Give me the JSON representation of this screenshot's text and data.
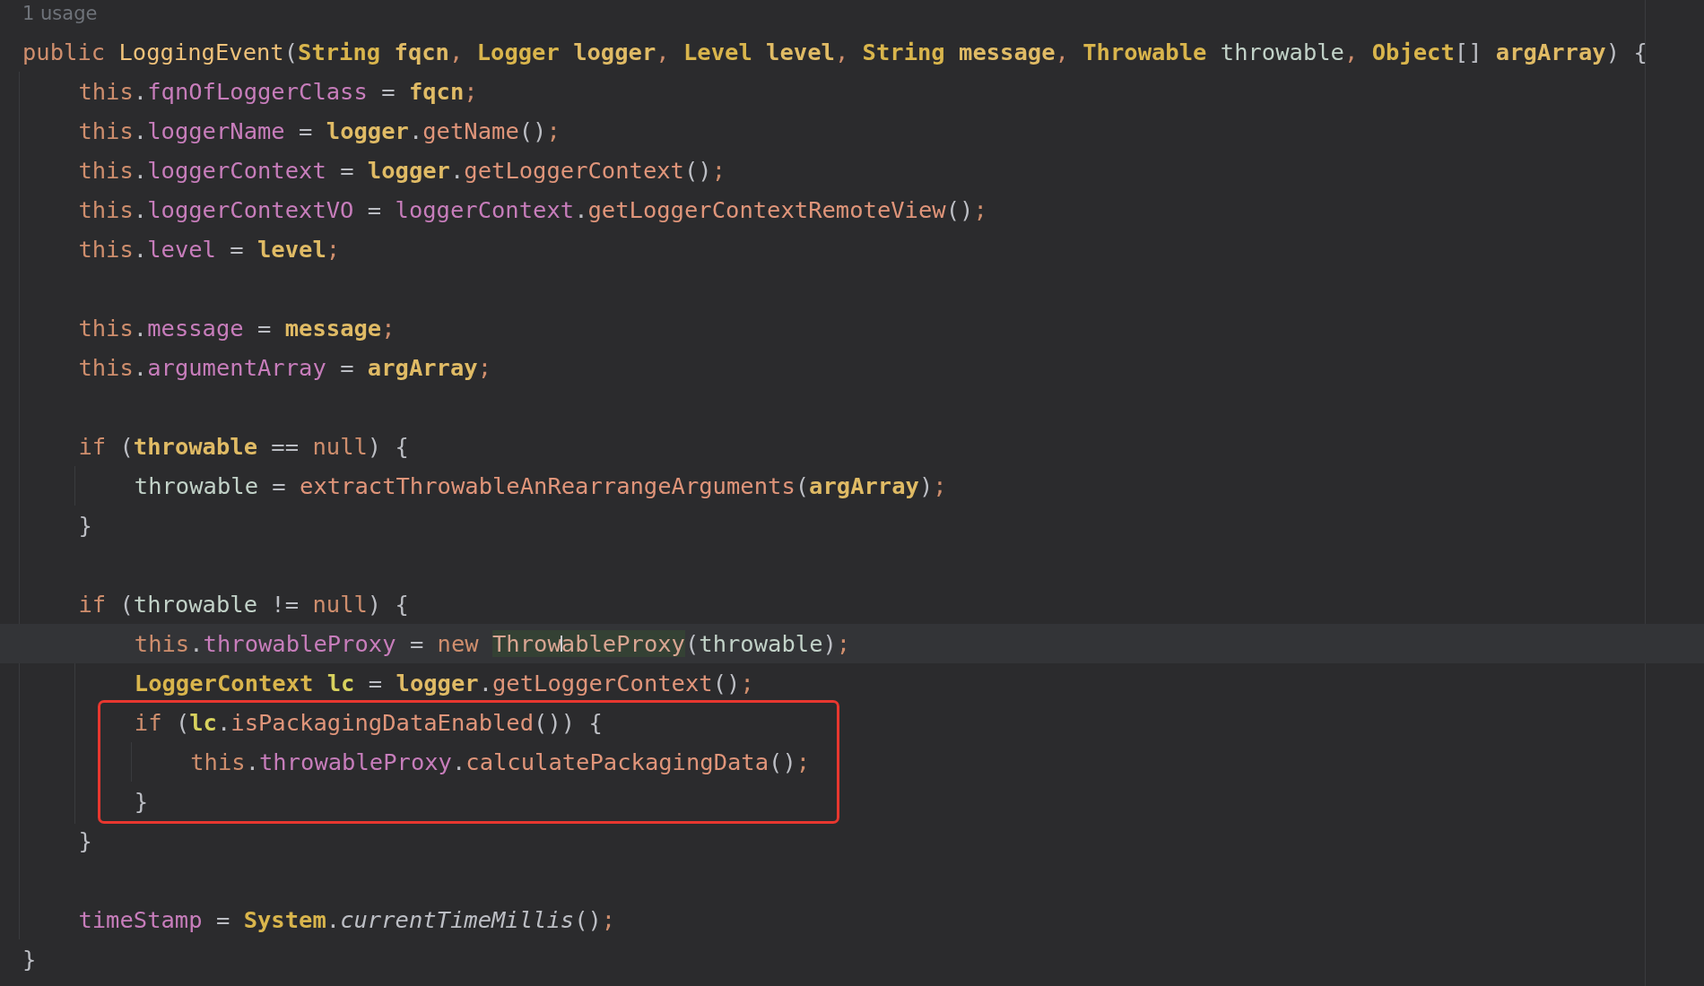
{
  "editor": {
    "usage_hint": "1 usage",
    "lines": [
      {
        "kind": "block",
        "boxed": false,
        "tokens": [
          {
            "text": "public ",
            "kind": "keyword"
          },
          {
            "text": "LoggingEvent",
            "kind": "ctor"
          },
          {
            "text": "(",
            "kind": "plain"
          },
          {
            "text": "String ",
            "kind": "type"
          },
          {
            "text": "fqcn",
            "kind": "param"
          },
          {
            "text": ", ",
            "kind": "semi"
          },
          {
            "text": "Logger ",
            "kind": "type"
          },
          {
            "text": "logger",
            "kind": "param"
          },
          {
            "text": ", ",
            "kind": "semi"
          },
          {
            "text": "Level ",
            "kind": "type"
          },
          {
            "text": "level",
            "kind": "param"
          },
          {
            "text": ", ",
            "kind": "semi"
          },
          {
            "text": "String ",
            "kind": "type"
          },
          {
            "text": "message",
            "kind": "param"
          },
          {
            "text": ", ",
            "kind": "semi"
          },
          {
            "text": "Throwable ",
            "kind": "type"
          },
          {
            "text": "throwable",
            "kind": "local"
          },
          {
            "text": ", ",
            "kind": "semi"
          },
          {
            "text": "Object",
            "kind": "type"
          },
          {
            "text": "[] ",
            "kind": "plain"
          },
          {
            "text": "argArray",
            "kind": "param"
          },
          {
            "text": ") {",
            "kind": "plain"
          }
        ],
        "children": [
          {
            "kind": "code",
            "tokens": [
              {
                "text": "this",
                "kind": "keyword"
              },
              {
                "text": ".",
                "kind": "plain"
              },
              {
                "text": "fqnOfLoggerClass",
                "kind": "field"
              },
              {
                "text": " = ",
                "kind": "plain"
              },
              {
                "text": "fqcn",
                "kind": "param"
              },
              {
                "text": ";",
                "kind": "semi"
              }
            ]
          },
          {
            "kind": "code",
            "tokens": [
              {
                "text": "this",
                "kind": "keyword"
              },
              {
                "text": ".",
                "kind": "plain"
              },
              {
                "text": "loggerName",
                "kind": "field"
              },
              {
                "text": " = ",
                "kind": "plain"
              },
              {
                "text": "logger",
                "kind": "param"
              },
              {
                "text": ".",
                "kind": "plain"
              },
              {
                "text": "getName",
                "kind": "method"
              },
              {
                "text": "()",
                "kind": "plain"
              },
              {
                "text": ";",
                "kind": "semi"
              }
            ]
          },
          {
            "kind": "code",
            "tokens": [
              {
                "text": "this",
                "kind": "keyword"
              },
              {
                "text": ".",
                "kind": "plain"
              },
              {
                "text": "loggerContext",
                "kind": "field"
              },
              {
                "text": " = ",
                "kind": "plain"
              },
              {
                "text": "logger",
                "kind": "param"
              },
              {
                "text": ".",
                "kind": "plain"
              },
              {
                "text": "getLoggerContext",
                "kind": "method"
              },
              {
                "text": "()",
                "kind": "plain"
              },
              {
                "text": ";",
                "kind": "semi"
              }
            ]
          },
          {
            "kind": "code",
            "tokens": [
              {
                "text": "this",
                "kind": "keyword"
              },
              {
                "text": ".",
                "kind": "plain"
              },
              {
                "text": "loggerContextVO",
                "kind": "field"
              },
              {
                "text": " = ",
                "kind": "plain"
              },
              {
                "text": "loggerContext",
                "kind": "field"
              },
              {
                "text": ".",
                "kind": "plain"
              },
              {
                "text": "getLoggerContextRemoteView",
                "kind": "method"
              },
              {
                "text": "()",
                "kind": "plain"
              },
              {
                "text": ";",
                "kind": "semi"
              }
            ]
          },
          {
            "kind": "code",
            "tokens": [
              {
                "text": "this",
                "kind": "keyword"
              },
              {
                "text": ".",
                "kind": "plain"
              },
              {
                "text": "level",
                "kind": "field"
              },
              {
                "text": " = ",
                "kind": "plain"
              },
              {
                "text": "level",
                "kind": "param"
              },
              {
                "text": ";",
                "kind": "semi"
              }
            ]
          },
          {
            "kind": "blank"
          },
          {
            "kind": "code",
            "tokens": [
              {
                "text": "this",
                "kind": "keyword"
              },
              {
                "text": ".",
                "kind": "plain"
              },
              {
                "text": "message",
                "kind": "field"
              },
              {
                "text": " = ",
                "kind": "plain"
              },
              {
                "text": "message",
                "kind": "param"
              },
              {
                "text": ";",
                "kind": "semi"
              }
            ]
          },
          {
            "kind": "code",
            "tokens": [
              {
                "text": "this",
                "kind": "keyword"
              },
              {
                "text": ".",
                "kind": "plain"
              },
              {
                "text": "argumentArray",
                "kind": "field"
              },
              {
                "text": " = ",
                "kind": "plain"
              },
              {
                "text": "argArray",
                "kind": "param"
              },
              {
                "text": ";",
                "kind": "semi"
              }
            ]
          },
          {
            "kind": "blank"
          },
          {
            "kind": "block",
            "boxed": false,
            "tokens": [
              {
                "text": "if ",
                "kind": "keyword"
              },
              {
                "text": "(",
                "kind": "plain"
              },
              {
                "text": "throwable",
                "kind": "param"
              },
              {
                "text": " == ",
                "kind": "plain"
              },
              {
                "text": "null",
                "kind": "keyword"
              },
              {
                "text": ") {",
                "kind": "plain"
              }
            ],
            "children": [
              {
                "kind": "code",
                "tokens": [
                  {
                    "text": "throwable",
                    "kind": "local"
                  },
                  {
                    "text": " = ",
                    "kind": "plain"
                  },
                  {
                    "text": "extractThrowableAnRearrangeArguments",
                    "kind": "method"
                  },
                  {
                    "text": "(",
                    "kind": "plain"
                  },
                  {
                    "text": "argArray",
                    "kind": "param"
                  },
                  {
                    "text": ")",
                    "kind": "plain"
                  },
                  {
                    "text": ";",
                    "kind": "semi"
                  }
                ]
              }
            ],
            "close": [
              {
                "text": "}",
                "kind": "plain"
              }
            ]
          },
          {
            "kind": "blank"
          },
          {
            "kind": "block",
            "boxed": false,
            "tokens": [
              {
                "text": "if ",
                "kind": "keyword"
              },
              {
                "text": "(",
                "kind": "plain"
              },
              {
                "text": "throwable",
                "kind": "local"
              },
              {
                "text": " != ",
                "kind": "plain"
              },
              {
                "text": "null",
                "kind": "keyword"
              },
              {
                "text": ") {",
                "kind": "plain"
              }
            ],
            "children": [
              {
                "kind": "code",
                "tokens": [
                  {
                    "text": "this",
                    "kind": "keyword"
                  },
                  {
                    "text": ".",
                    "kind": "plain"
                  },
                  {
                    "text": "throwableProxy",
                    "kind": "field"
                  },
                  {
                    "text": " = ",
                    "kind": "plain"
                  },
                  {
                    "text": "new ",
                    "kind": "keyword"
                  },
                  {
                    "text": "Throw",
                    "kind": "ref",
                    "highlight": true,
                    "caret": true
                  },
                  {
                    "text": "ableProxy",
                    "kind": "ref",
                    "highlight": true,
                    "caret": false
                  },
                  {
                    "text": "(",
                    "kind": "plain"
                  },
                  {
                    "text": "throwable",
                    "kind": "local"
                  },
                  {
                    "text": ")",
                    "kind": "plain"
                  },
                  {
                    "text": ";",
                    "kind": "semi"
                  }
                ]
              },
              {
                "kind": "code",
                "tokens": [
                  {
                    "text": "LoggerContext ",
                    "kind": "type"
                  },
                  {
                    "text": "lc",
                    "kind": "var"
                  },
                  {
                    "text": " = ",
                    "kind": "plain"
                  },
                  {
                    "text": "logger",
                    "kind": "param"
                  },
                  {
                    "text": ".",
                    "kind": "plain"
                  },
                  {
                    "text": "getLoggerContext",
                    "kind": "method"
                  },
                  {
                    "text": "()",
                    "kind": "plain"
                  },
                  {
                    "text": ";",
                    "kind": "semi"
                  }
                ]
              },
              {
                "kind": "block",
                "boxed": true,
                "tokens": [
                  {
                    "text": "if ",
                    "kind": "keyword"
                  },
                  {
                    "text": "(",
                    "kind": "plain"
                  },
                  {
                    "text": "lc",
                    "kind": "var"
                  },
                  {
                    "text": ".",
                    "kind": "plain"
                  },
                  {
                    "text": "isPackagingDataEnabled",
                    "kind": "method"
                  },
                  {
                    "text": "()) {",
                    "kind": "plain"
                  }
                ],
                "children": [
                  {
                    "kind": "code",
                    "tokens": [
                      {
                        "text": "this",
                        "kind": "keyword"
                      },
                      {
                        "text": ".",
                        "kind": "plain"
                      },
                      {
                        "text": "throwableProxy",
                        "kind": "field"
                      },
                      {
                        "text": ".",
                        "kind": "plain"
                      },
                      {
                        "text": "calculatePackagingData",
                        "kind": "method"
                      },
                      {
                        "text": "()",
                        "kind": "plain"
                      },
                      {
                        "text": ";",
                        "kind": "semi"
                      }
                    ]
                  }
                ],
                "close": [
                  {
                    "text": "}",
                    "kind": "plain"
                  }
                ]
              }
            ],
            "close": [
              {
                "text": "}",
                "kind": "plain"
              }
            ]
          },
          {
            "kind": "blank"
          },
          {
            "kind": "code",
            "tokens": [
              {
                "text": "timeStamp",
                "kind": "field"
              },
              {
                "text": " = ",
                "kind": "plain"
              },
              {
                "text": "System",
                "kind": "type"
              },
              {
                "text": ".",
                "kind": "plain"
              },
              {
                "text": "currentTimeMillis",
                "kind": "static"
              },
              {
                "text": "()",
                "kind": "plain"
              },
              {
                "text": ";",
                "kind": "semi"
              }
            ]
          }
        ],
        "close": [
          {
            "text": "}",
            "kind": "plain"
          }
        ]
      }
    ]
  }
}
